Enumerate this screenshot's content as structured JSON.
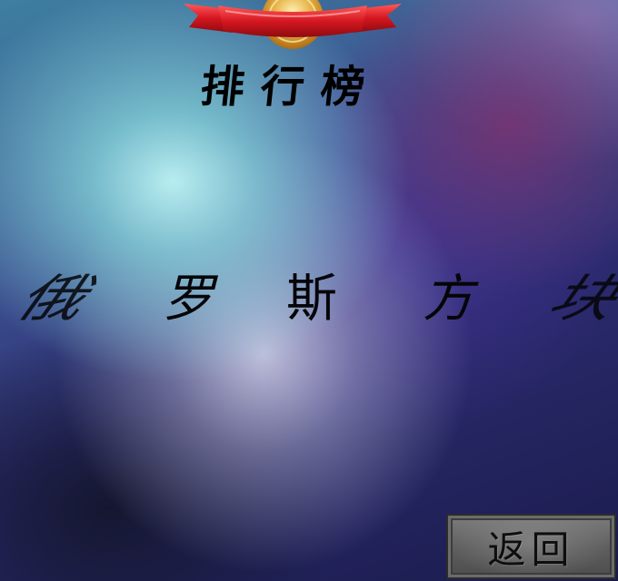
{
  "leaderboard": {
    "title": "排行榜"
  },
  "game": {
    "characters": [
      "俄",
      "罗",
      "斯",
      "方",
      "块"
    ]
  },
  "controls": {
    "back_label": "返回"
  },
  "colors": {
    "ribbon": "#d41820",
    "medal": "#e8a93a",
    "button_face": "#666666",
    "text": "#000000"
  }
}
